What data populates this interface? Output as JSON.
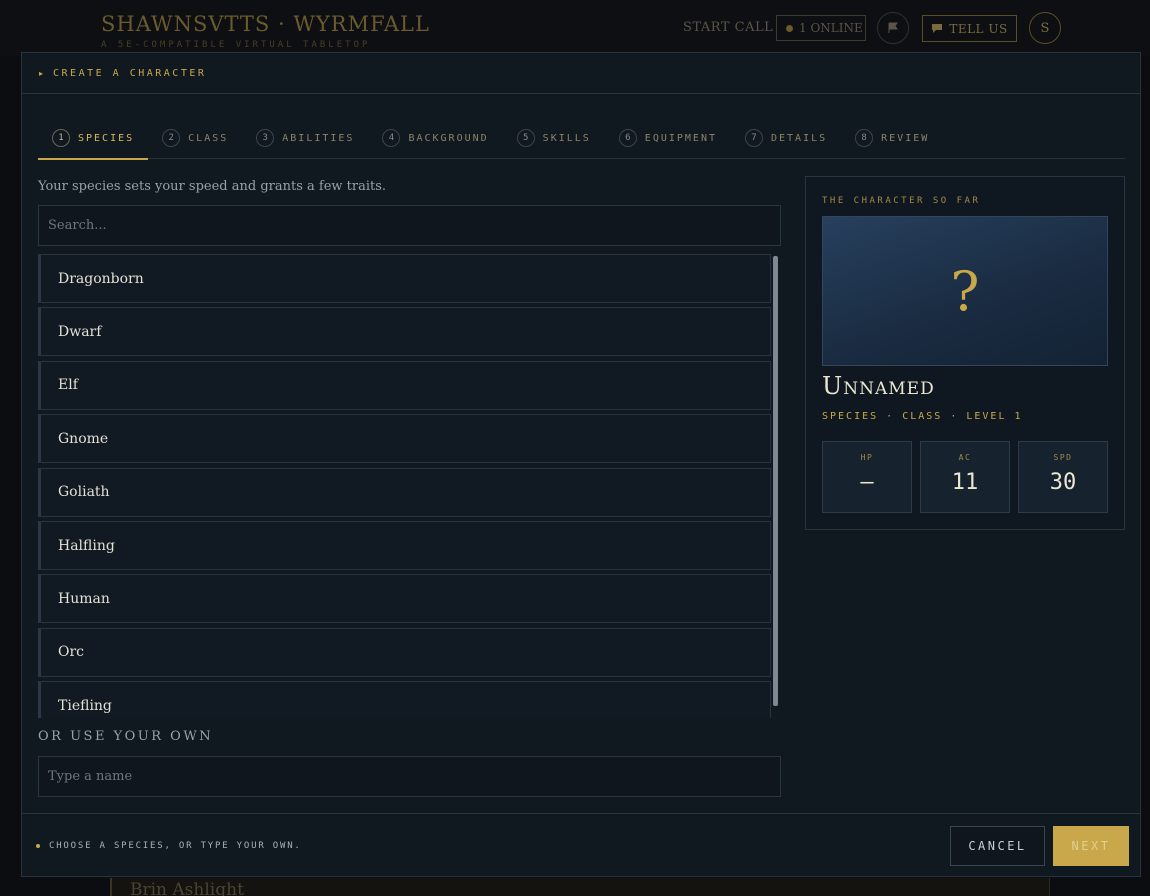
{
  "app": {
    "title": "SHAWNSVTTS · WYRMFALL",
    "subtitle": "A 5E-COMPATIBLE VIRTUAL TABLETOP",
    "start_call": "START CALL",
    "online": "1 ONLINE",
    "tell_us": "TELL US",
    "avatar_initial": "S",
    "background_card": "Brin Ashlight"
  },
  "modal": {
    "title": "CREATE A CHARACTER",
    "steps": [
      {
        "num": "1",
        "label": "SPECIES"
      },
      {
        "num": "2",
        "label": "CLASS"
      },
      {
        "num": "3",
        "label": "ABILITIES"
      },
      {
        "num": "4",
        "label": "BACKGROUND"
      },
      {
        "num": "5",
        "label": "SKILLS"
      },
      {
        "num": "6",
        "label": "EQUIPMENT"
      },
      {
        "num": "7",
        "label": "DETAILS"
      },
      {
        "num": "8",
        "label": "REVIEW"
      }
    ],
    "active_step": 0,
    "intro": "Your species sets your speed and grants a few traits.",
    "search_placeholder": "Search...",
    "species": [
      "Dragonborn",
      "Dwarf",
      "Elf",
      "Gnome",
      "Goliath",
      "Halfling",
      "Human",
      "Orc",
      "Tiefling"
    ],
    "own_label": "OR USE YOUR OWN",
    "own_placeholder": "Type a name",
    "footer_hint": "CHOOSE A SPECIES, OR TYPE YOUR OWN.",
    "cancel": "CANCEL",
    "next": "NEXT"
  },
  "summary": {
    "title": "THE CHARACTER SO FAR",
    "portrait_glyph": "?",
    "name": "Unnamed",
    "meta": "SPECIES · CLASS · LEVEL 1",
    "stats": [
      {
        "label": "HP",
        "value": "—"
      },
      {
        "label": "AC",
        "value": "11"
      },
      {
        "label": "SPD",
        "value": "30"
      }
    ]
  },
  "colors": {
    "accent": "#c9a84c",
    "modal_bg": "#101820"
  }
}
